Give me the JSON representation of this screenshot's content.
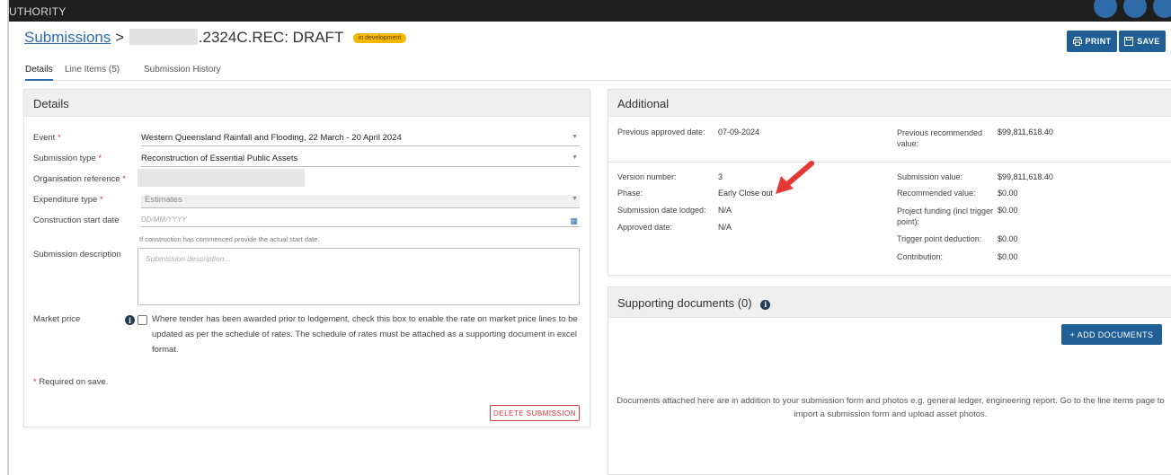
{
  "topbar": {
    "brand": "UTHORITY"
  },
  "breadcrumb": {
    "link": "Submissions",
    "separator": ">",
    "title": ".2324C.REC: DRAFT",
    "badge": "in development"
  },
  "toolbar": {
    "print_label": "PRINT",
    "save_label": "SAVE"
  },
  "tabs": [
    {
      "label": "Details"
    },
    {
      "label": "Line Items (5)"
    },
    {
      "label": "Submission History"
    }
  ],
  "details": {
    "heading": "Details",
    "event_label": "Event",
    "event_value": "Western Queensland Rainfall and Flooding, 22 March - 20 April 2024",
    "submission_type_label": "Submission type",
    "submission_type_value": "Reconstruction of Essential Public Assets",
    "org_ref_label": "Organisation reference",
    "expenditure_label": "Expenditure type",
    "expenditure_value": "Estimates",
    "construction_label": "Construction start date",
    "construction_placeholder": "DD/MM/YYYY",
    "construction_hint": "If construction has commenced provide the actual start date.",
    "description_label": "Submission description",
    "description_placeholder": "Submission description...",
    "market_label": "Market price",
    "market_text": "Where tender has been awarded prior to lodgement, check this box to enable the rate on market price lines to be updated as per the schedule of rates. The schedule of rates must be attached as a supporting document in excel format.",
    "required_note": "Required on save.",
    "asterisk": "*",
    "delete_label": "DELETE SUBMISSION"
  },
  "additional": {
    "heading": "Additional",
    "prev_approved_date_label": "Previous approved date:",
    "prev_approved_date_value": "07-09-2024",
    "prev_recommended_label": "Previous recommended value:",
    "prev_recommended_value": "$99,811,618.40",
    "version_label": "Version number:",
    "version_value": "3",
    "phase_label": "Phase:",
    "phase_value": "Early Close out",
    "date_lodged_label": "Submission date lodged:",
    "date_lodged_value": "N/A",
    "approved_date_label": "Approved date:",
    "approved_date_value": "N/A",
    "submission_value_label": "Submission value:",
    "submission_value_value": "$99,811,618.40",
    "recommended_label": "Recommended value:",
    "recommended_value": "$0.00",
    "project_funding_label": "Project funding (incl trigger point):",
    "project_funding_value": "$0.00",
    "trigger_label": "Trigger point deduction:",
    "trigger_value": "$0.00",
    "contribution_label": "Contribution:",
    "contribution_value": "$0.00"
  },
  "supporting": {
    "heading": "Supporting documents (0)",
    "add_label": "+ ADD DOCUMENTS",
    "note": "Documents attached here are in addition to your submission form and photos e.g. general ledger, engineering report. Go to the line items page to import a submission form and upload asset photos."
  },
  "colors": {
    "primary": "#1f5f96",
    "badge": "#f5b800",
    "danger": "#d13b3b",
    "arrow": "#e53935"
  }
}
